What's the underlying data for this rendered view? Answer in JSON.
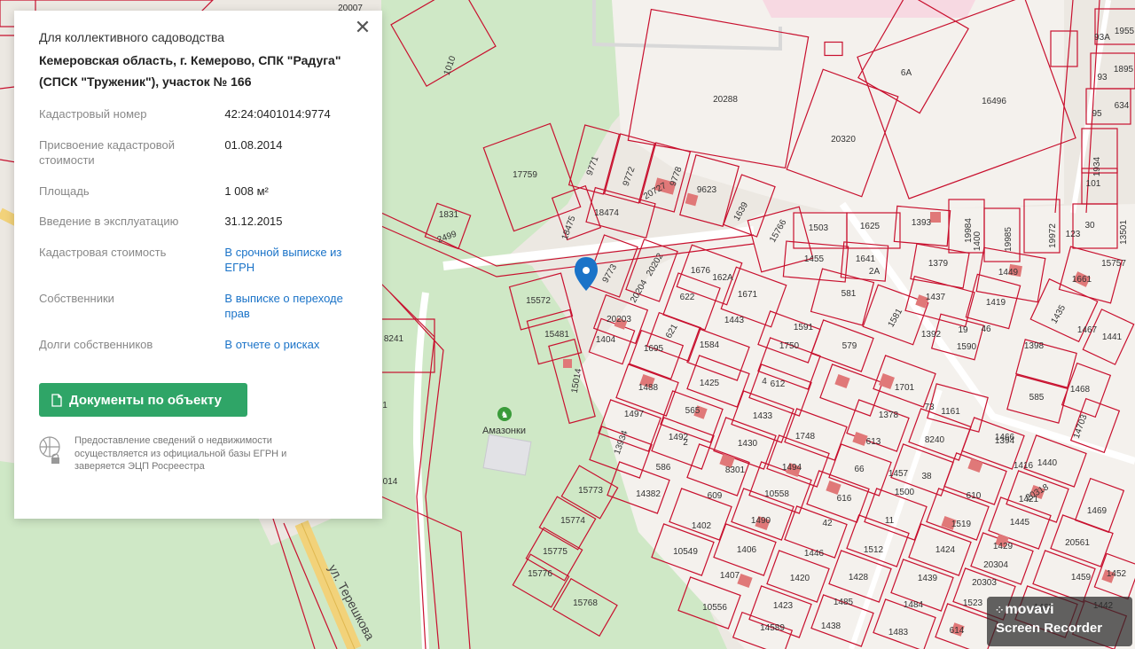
{
  "card": {
    "purpose": "Для коллективного садоводства",
    "address": "Кемеровская область, г. Кемерово, СПК \"Радуга\" (СПСК \"Труженик\"), участок № 166",
    "rows": [
      {
        "label": "Кадастровый номер",
        "value": "42:24:0401014:9774",
        "link": false
      },
      {
        "label": "Присвоение кадастровой стоимости",
        "value": "01.08.2014",
        "link": false
      },
      {
        "label": "Площадь",
        "value": "1 008 м²",
        "link": false
      },
      {
        "label": "Введение в эксплуатацию",
        "value": "31.12.2015",
        "link": false
      },
      {
        "label": "Кадастровая стоимость",
        "value": "В срочной выписке из ЕГРН",
        "link": true
      },
      {
        "label": "Собственники",
        "value": "В выписке о переходе прав",
        "link": true
      },
      {
        "label": "Долги собственников",
        "value": "В отчете о рисках",
        "link": true
      }
    ],
    "docs_button": "Документы по объекту",
    "disclaimer": "Предоставление сведений о недвижимости осуществляется из официальной базы ЕГРН и заверяется ЭЦП Росреестра",
    "close_icon": "close-icon"
  },
  "map": {
    "poi_label": "Амазонки",
    "street_label": "ул. Терешкова",
    "plots": [
      "20007",
      "1010",
      "20288",
      "16496",
      "20320",
      "6А",
      "93А",
      "93",
      "95",
      "1955",
      "1895",
      "634",
      "1934",
      "101",
      "17759",
      "9771",
      "9772",
      "9778",
      "20727",
      "9623",
      "1639",
      "18475",
      "18474",
      "1831",
      "2499",
      "15766",
      "1503",
      "1625",
      "1393",
      "19984",
      "1400",
      "19985",
      "19972",
      "123",
      "30",
      "13501",
      "15757",
      "1455",
      "1641",
      "1379",
      "1449",
      "9773",
      "20202",
      "1676",
      "162А",
      "1671",
      "15572",
      "15481",
      "20204",
      "20203",
      "1404",
      "622",
      "1443",
      "581",
      "2А",
      "1581",
      "1437",
      "1419",
      "1661",
      "1435",
      "15014",
      "8241",
      "621",
      "1695",
      "1584",
      "1591",
      "579",
      "1750",
      "1392",
      "19",
      "46",
      "1590",
      "1398",
      "1467",
      "1441",
      "1488",
      "1425",
      "612",
      "1701",
      "1161",
      "585",
      "1468",
      "14703",
      "1497",
      "565",
      "1433",
      "1378",
      "73",
      "8240",
      "1394",
      "13934",
      "1492",
      "1430",
      "1748",
      "613",
      "1466",
      "1416",
      "1440",
      "586",
      "8301",
      "1494",
      "66",
      "1457",
      "38",
      "20318",
      "1469",
      "14382",
      "609",
      "10558",
      "1500",
      "610",
      "1421",
      "1445",
      "15773",
      "1402",
      "1490",
      "616",
      "42",
      "11",
      "1519",
      "1429",
      "20561",
      "15774",
      "10549",
      "1406",
      "1446",
      "1512",
      "1424",
      "20304",
      "1459",
      "15775",
      "1407",
      "1420",
      "1428",
      "1439",
      "20303",
      "1452",
      "15776",
      "15768",
      "10556",
      "1423",
      "1485",
      "1484",
      "1523",
      "1442",
      "14589",
      "1438",
      "1483",
      "614",
      "1463",
      "014",
      "1",
      "4",
      "2"
    ]
  },
  "watermark": {
    "brand": "movavi",
    "product": "Screen Recorder"
  },
  "colors": {
    "parcel_border": "#c8102e",
    "building": "#e07878",
    "green": "#cfe8c6",
    "background": "#ece8e2",
    "button": "#2fa567",
    "link": "#1a73c8"
  }
}
